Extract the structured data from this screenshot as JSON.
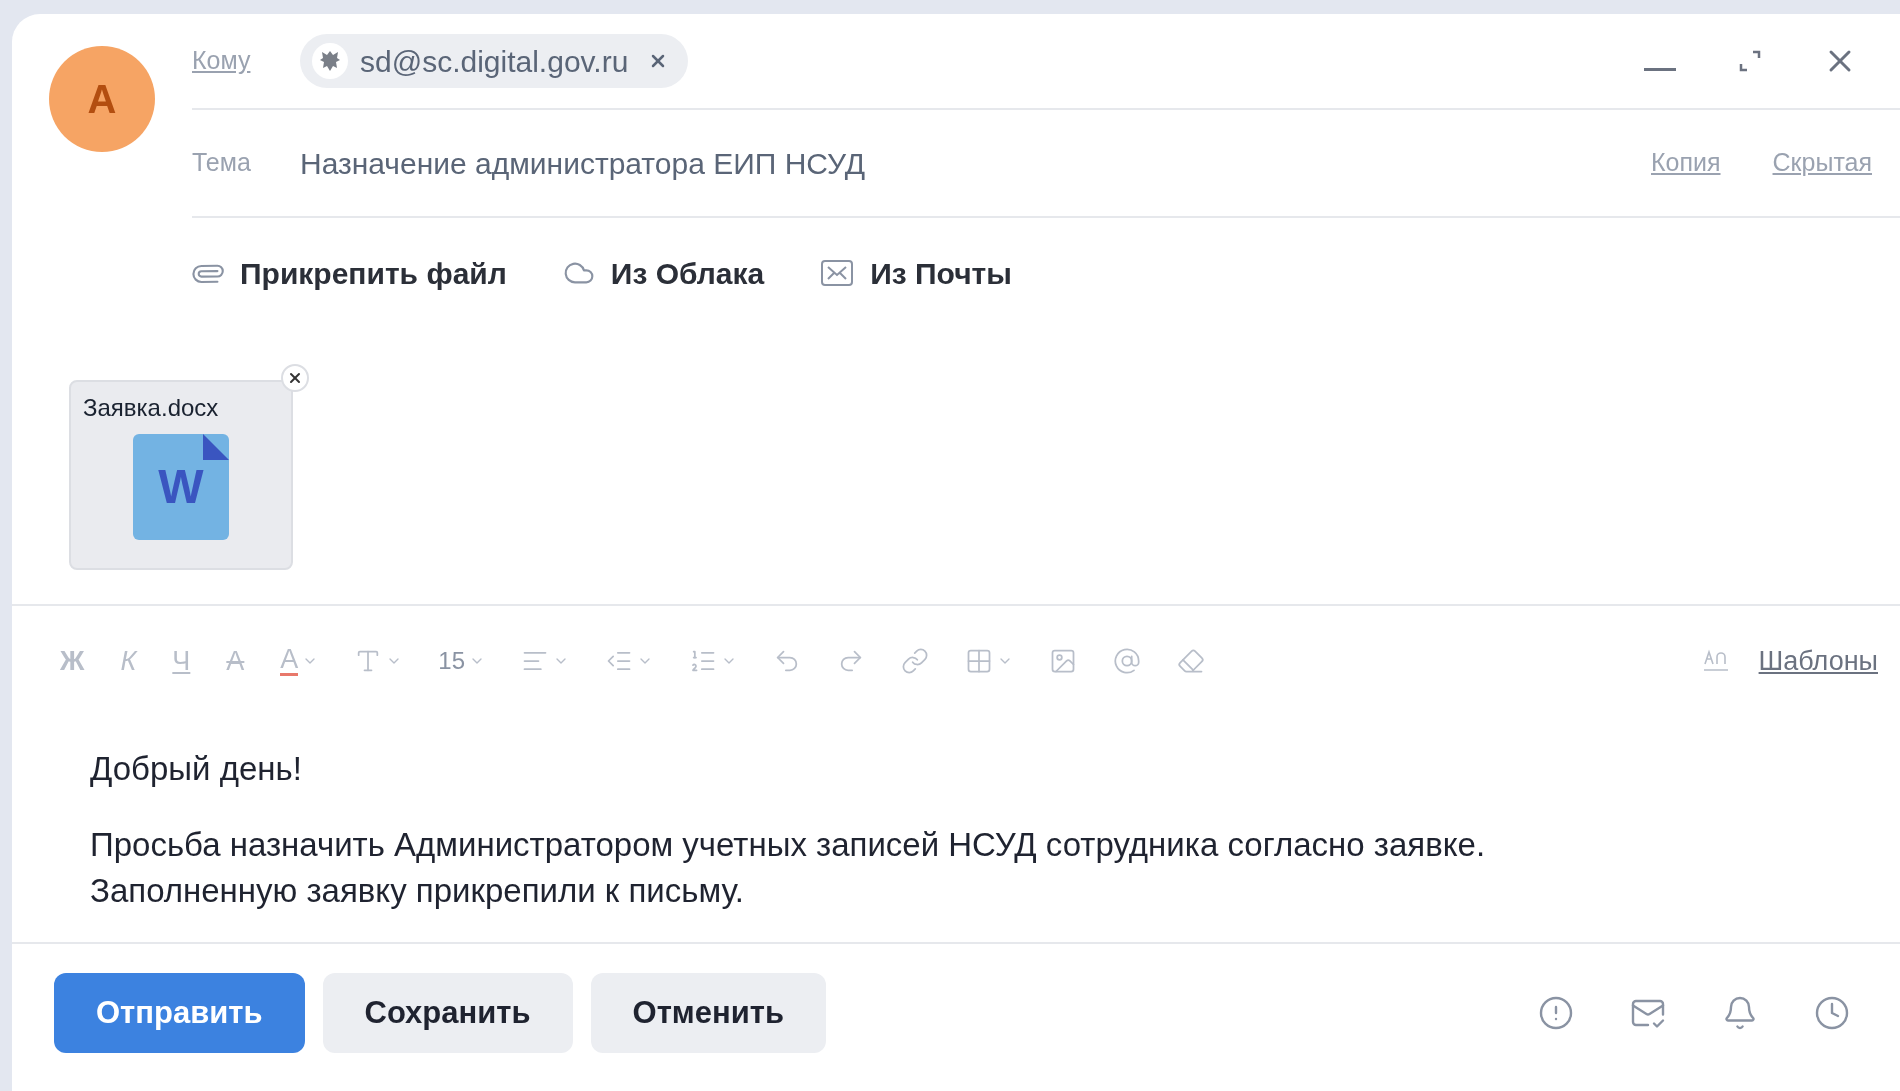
{
  "avatar": {
    "letter": "A"
  },
  "to": {
    "label": "Кому",
    "recipients": [
      {
        "email": "sd@sc.digital.gov.ru"
      }
    ]
  },
  "subject": {
    "label": "Тема",
    "value": "Назначение администратора ЕИП НСУД"
  },
  "cc_links": [
    "Копия",
    "Скрытая"
  ],
  "attach_actions": [
    {
      "kind": "file",
      "label": "Прикрепить файл"
    },
    {
      "kind": "cloud",
      "label": "Из Облака"
    },
    {
      "kind": "mail",
      "label": "Из Почты"
    }
  ],
  "attachments": [
    {
      "name": "Заявка.docx",
      "icon_letter": "W"
    }
  ],
  "toolbar": [
    {
      "kind": "bold",
      "label": "Ж",
      "dropdown": false
    },
    {
      "kind": "italic",
      "label": "К",
      "dropdown": false
    },
    {
      "kind": "underline",
      "label": "Ч",
      "dropdown": false
    },
    {
      "kind": "strike",
      "label": "A",
      "dropdown": false
    },
    {
      "kind": "color",
      "label": "A",
      "dropdown": true
    },
    {
      "kind": "size",
      "dropdown": true
    },
    {
      "kind": "fontsize",
      "label": "15",
      "dropdown": true
    },
    {
      "kind": "align",
      "dropdown": true
    },
    {
      "kind": "indent",
      "dropdown": true
    },
    {
      "kind": "list",
      "dropdown": true
    },
    {
      "kind": "undo",
      "dropdown": false
    },
    {
      "kind": "redo",
      "dropdown": false
    },
    {
      "kind": "link",
      "dropdown": false
    },
    {
      "kind": "table",
      "dropdown": true
    },
    {
      "kind": "image",
      "dropdown": false
    },
    {
      "kind": "mention",
      "dropdown": false
    },
    {
      "kind": "eraser",
      "dropdown": false
    }
  ],
  "templates": {
    "label": "Шаблоны"
  },
  "body": {
    "greeting": "Добрый день!",
    "lines": [
      "Просьба назначить Администратором учетных записей НСУД сотрудника согласно заявке.",
      "Заполненную заявку прикрепили к письму."
    ]
  },
  "buttons": [
    {
      "kind": "primary",
      "label": "Отправить"
    },
    {
      "kind": "secondary",
      "label": "Сохранить"
    },
    {
      "kind": "secondary",
      "label": "Отменить"
    }
  ]
}
